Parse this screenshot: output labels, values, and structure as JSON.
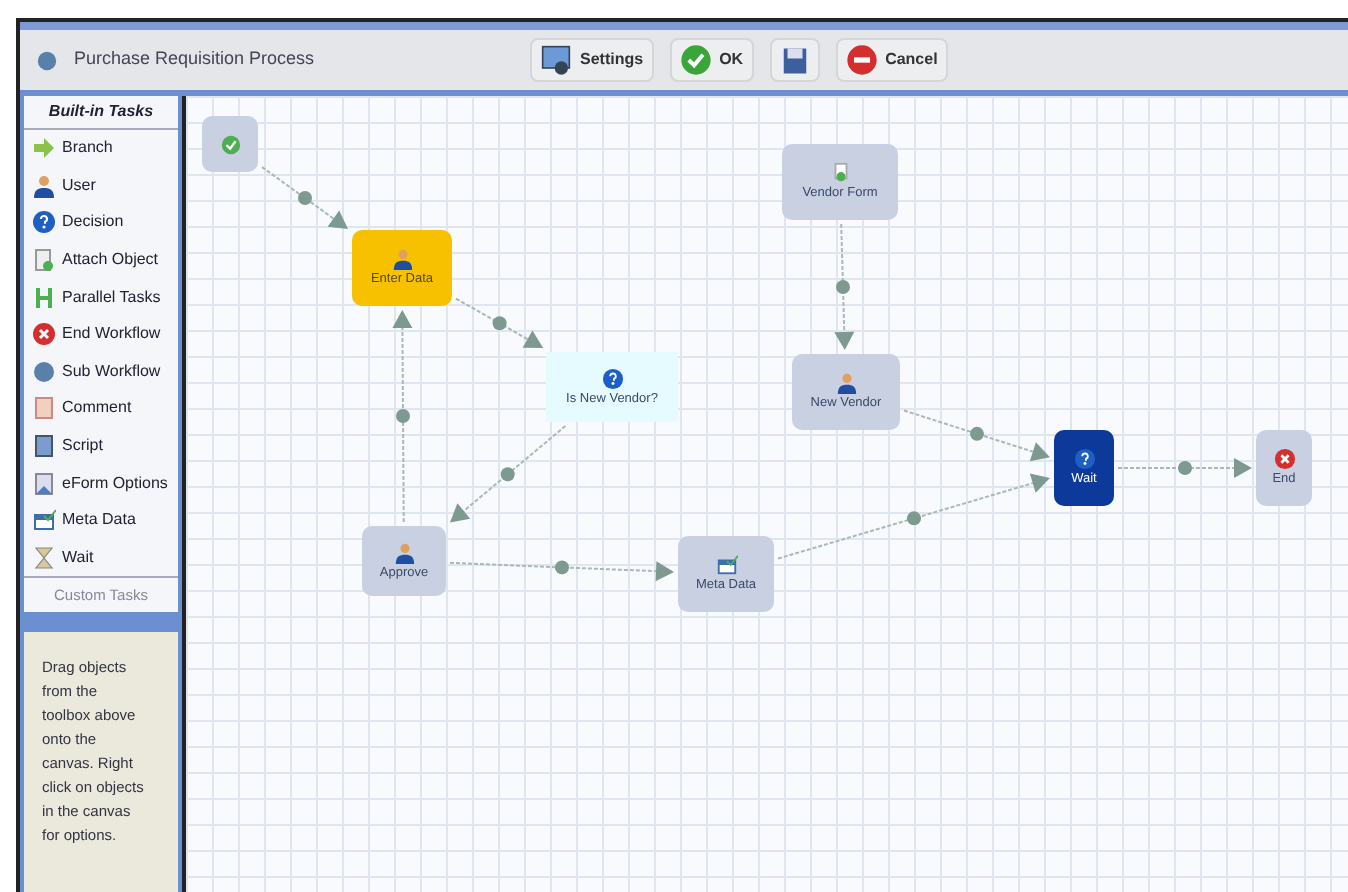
{
  "window": {
    "title": "Purchase Requisition Process"
  },
  "toolbar": [
    {
      "kind": "settings",
      "label": "Settings"
    },
    {
      "kind": "ok",
      "label": "OK"
    },
    {
      "kind": "save"
    },
    {
      "kind": "cancel",
      "label": "Cancel"
    }
  ],
  "sidebar": {
    "header": "Built-in Tasks",
    "items": [
      {
        "kind": "branch",
        "label": "Branch"
      },
      {
        "kind": "user",
        "label": "User"
      },
      {
        "kind": "decision",
        "label": "Decision"
      },
      {
        "kind": "attach",
        "label": "Attach Object"
      },
      {
        "kind": "parallel",
        "label": "Parallel Tasks"
      },
      {
        "kind": "end",
        "label": "End Workflow"
      },
      {
        "kind": "sub",
        "label": "Sub Workflow"
      },
      {
        "kind": "comment",
        "label": "Comment"
      },
      {
        "kind": "script",
        "label": "Script"
      },
      {
        "kind": "eform",
        "label": "eForm Options"
      },
      {
        "kind": "meta",
        "label": "Meta Data"
      },
      {
        "kind": "wait",
        "label": "Wait"
      }
    ],
    "custom_header": "Custom Tasks",
    "help": "Drag objects from the toolbox above onto the canvas. Right click on objects in the canvas for options."
  },
  "canvas": {
    "nodes": [
      {
        "kind": "start",
        "selected": false
      },
      {
        "kind": "user",
        "label": "Enter Data",
        "selected": true
      },
      {
        "kind": "decision",
        "label": "Is New Vendor?",
        "selected": false
      },
      {
        "kind": "user",
        "label": "Approve",
        "selected": false
      },
      {
        "kind": "meta",
        "label": "Meta Data",
        "selected": false
      },
      {
        "kind": "form",
        "label": "Vendor Form",
        "selected": false
      },
      {
        "kind": "user",
        "label": "New Vendor",
        "selected": false
      },
      {
        "kind": "wait",
        "label": "Wait",
        "selected": false
      },
      {
        "kind": "end",
        "label": "End",
        "selected": false
      }
    ]
  }
}
